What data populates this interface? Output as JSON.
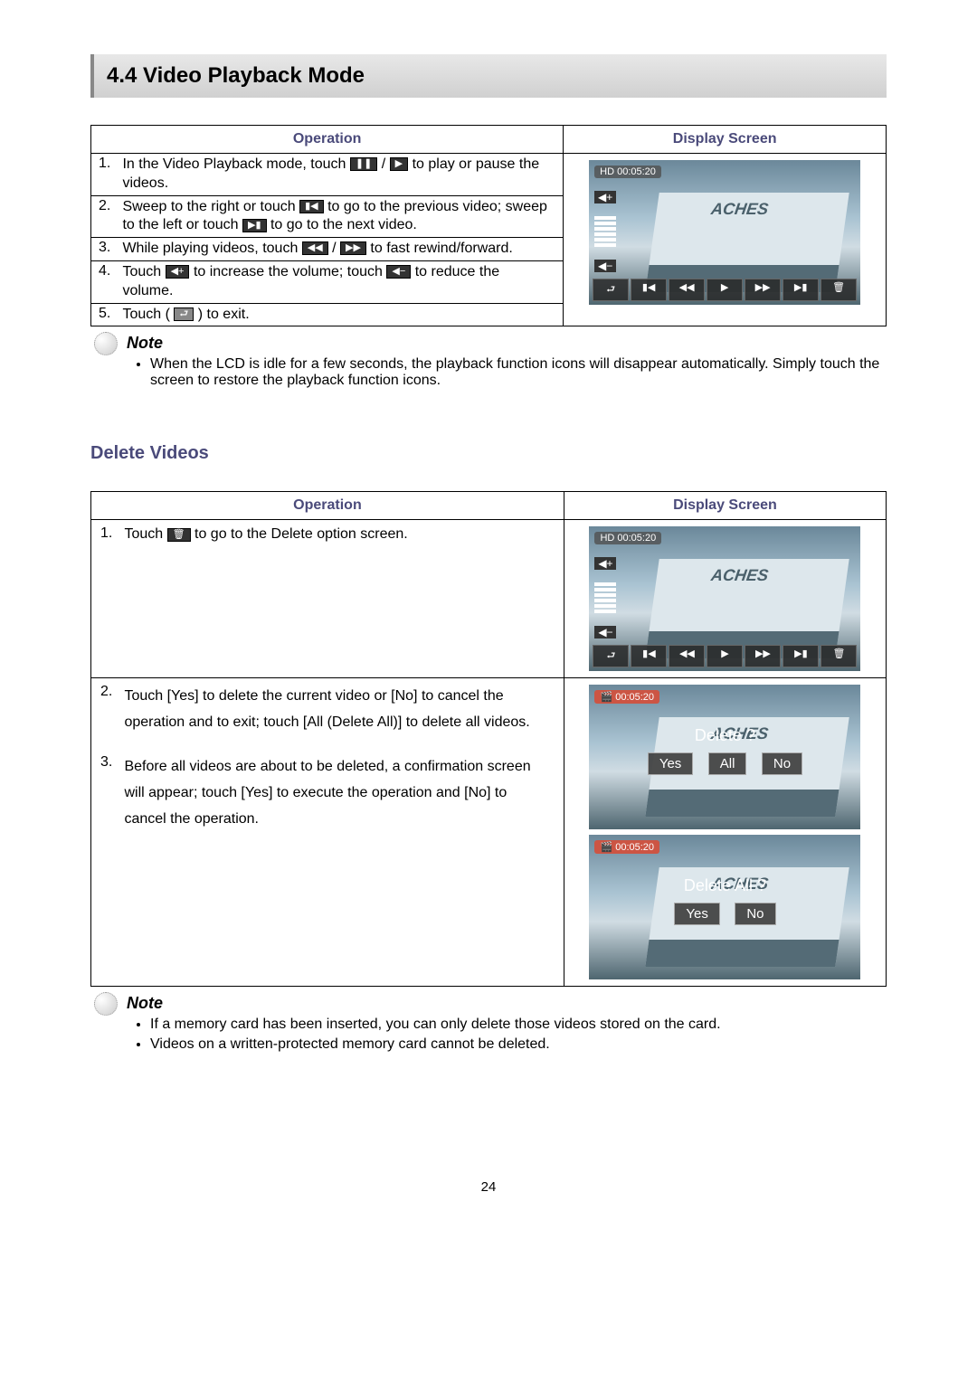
{
  "section_title": "4.4 Video Playback Mode",
  "headers": {
    "operation": "Operation",
    "display": "Display Screen"
  },
  "playback_steps": {
    "s1a": "In the Video Playback mode, touch ",
    "s1b": " to play or pause the videos.",
    "s2a": "Sweep to the right or touch ",
    "s2b": " to go to the previous video; sweep to the left or touch ",
    "s2c": " to go to the next video.",
    "s3a": "While playing videos, touch ",
    "s3b": " to fast rewind/forward.",
    "s4a": "Touch ",
    "s4b": " to increase the volume; touch ",
    "s4c": " to reduce the volume.",
    "s5a": "Touch ( ",
    "s5b": " ) to exit."
  },
  "nums": {
    "n1": "1.",
    "n2": "2.",
    "n3": "3.",
    "n4": "4.",
    "n5": "5."
  },
  "note_label": "Note",
  "note1": "When the LCD is idle for a few seconds, the playback function icons will disappear automatically. Simply touch the screen to restore the playback function icons.",
  "delete_title": "Delete Videos",
  "delete_steps": {
    "d1": "Touch ",
    "d1b": " to go to the Delete option screen.",
    "d2": "Touch [Yes] to delete the current video or [No] to cancel the operation and to exit; touch [All (Delete All)] to delete all videos.",
    "d3": "Before all videos are about to be deleted, a confirmation screen will appear; touch [Yes] to execute the operation and [No] to cancel the operation."
  },
  "note2a": "If a memory card has been inserted, you can only delete those videos stored on the card.",
  "note2b": "Videos on a written-protected memory card cannot be deleted.",
  "screen": {
    "hd_time": "HD 00:05:20",
    "del_time": "00:05:20",
    "delete_q": "Delete ?",
    "delete_all_q": "Delete All ?",
    "yes": "Yes",
    "all": "All",
    "no": "No"
  },
  "page_number": "24"
}
